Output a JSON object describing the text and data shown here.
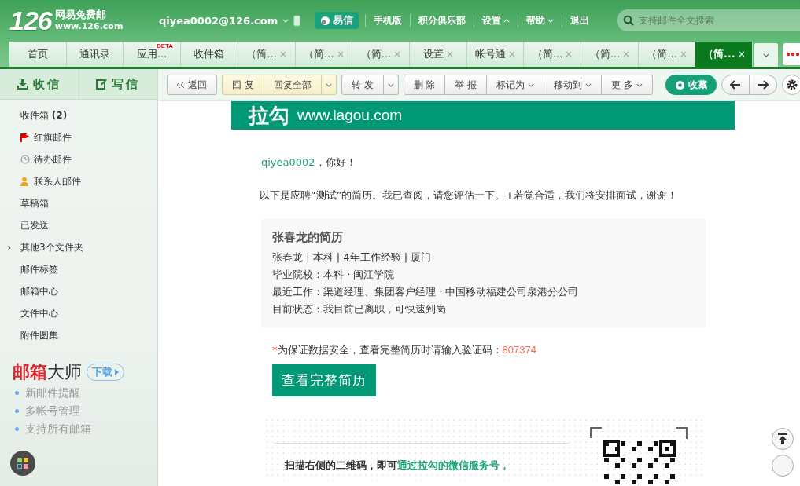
{
  "header": {
    "logo": {
      "number": "126",
      "name": "网易免费邮",
      "url": "www.126.com"
    },
    "account": "qiyea0002@126.com",
    "yixin": "易信",
    "links": [
      {
        "label": "手机版",
        "kind": "link"
      },
      {
        "label": "积分俱乐部",
        "kind": "link"
      },
      {
        "label": "设置",
        "kind": "menu-up"
      },
      {
        "label": "帮助",
        "kind": "menu-down"
      },
      {
        "label": "退出",
        "kind": "link"
      }
    ],
    "search": {
      "placeholder": "支持邮件全文搜索"
    }
  },
  "tabs": [
    {
      "label": "首页",
      "selected": false,
      "closable": false
    },
    {
      "label": "通讯录",
      "selected": false,
      "closable": false
    },
    {
      "label": "应用...",
      "selected": false,
      "closable": false,
      "badge": "BETA"
    },
    {
      "label": "收件箱",
      "selected": false,
      "closable": false
    },
    {
      "label": "（简...",
      "selected": false,
      "closable": true
    },
    {
      "label": "（简...",
      "selected": false,
      "closable": true
    },
    {
      "label": "（简...",
      "selected": false,
      "closable": true
    },
    {
      "label": "设置",
      "selected": false,
      "closable": true
    },
    {
      "label": "帐号通",
      "selected": false,
      "closable": true
    },
    {
      "label": "（简...",
      "selected": false,
      "closable": true
    },
    {
      "label": "（简...",
      "selected": false,
      "closable": true
    },
    {
      "label": "（简...",
      "selected": false,
      "closable": true
    },
    {
      "label": "（简...",
      "selected": true,
      "closable": true
    }
  ],
  "sidebar": {
    "receive": "收信",
    "compose": "写信",
    "folders": [
      {
        "label": "收件箱 **(2)**",
        "kind": "plain"
      },
      {
        "label": "红旗邮件",
        "kind": "flag"
      },
      {
        "label": "待办邮件",
        "kind": "clock"
      },
      {
        "label": "联系人邮件",
        "kind": "contact"
      },
      {
        "label": "草稿箱",
        "kind": "plain"
      },
      {
        "label": "已发送",
        "kind": "plain"
      },
      {
        "label": "其他3个文件夹",
        "kind": "group"
      },
      {
        "label": "邮件标签",
        "kind": "plain"
      },
      {
        "label": "邮箱中心",
        "kind": "plain"
      },
      {
        "label": "文件中心",
        "kind": "plain"
      },
      {
        "label": "附件图集",
        "kind": "plain"
      }
    ],
    "promo": {
      "brand_red": "邮箱",
      "brand_dark": "大师",
      "download": "下载",
      "features": [
        "新邮件提醒",
        "多帐号管理",
        "支持所有邮箱"
      ]
    }
  },
  "toolbar": {
    "back": "返回",
    "groups": [
      {
        "kind": "reply",
        "buttons": [
          {
            "kind": "text",
            "label": "回 复"
          },
          {
            "kind": "text",
            "label": "回复全部"
          },
          {
            "kind": "menu"
          }
        ]
      },
      {
        "kind": "plain",
        "buttons": [
          {
            "kind": "text",
            "label": "转 发"
          },
          {
            "kind": "menu"
          }
        ]
      },
      {
        "kind": "plain",
        "buttons": [
          {
            "kind": "text",
            "label": "删 除"
          },
          {
            "kind": "text",
            "label": "举 报"
          },
          {
            "kind": "dropdown",
            "label": "标记为"
          },
          {
            "kind": "dropdown",
            "label": "移动到"
          },
          {
            "kind": "dropdown",
            "label": "更 多"
          }
        ]
      }
    ],
    "collect": "收藏"
  },
  "email": {
    "banner": {
      "logo": "拉勾",
      "url": "www.lagou.com"
    },
    "greeting_name": "qiyea0002",
    "greeting": "，你好！",
    "intro": "以下是应聘“测试”的简历。我已查阅，请您评估一下。+若觉合适，我们将安排面试，谢谢！",
    "resume": {
      "title": "张春龙的简历",
      "lines": [
        "张春龙 | 本科 | 4年工作经验 | 厦门",
        "毕业院校：本科 · 闽江学院",
        "最近工作：渠道经理、集团客户经理 · 中国移动福建公司泉港分公司",
        "目前状态：我目前已离职，可快速到岗"
      ]
    },
    "notice_mark": "*",
    "notice": "为保证数据安全，查看完整简历时请输入验证码：",
    "code": "807374",
    "button": "查看完整简历",
    "qr_text": "扫描右侧的二维码，即可",
    "qr_link": "通过拉勾的微信服务号，"
  }
}
